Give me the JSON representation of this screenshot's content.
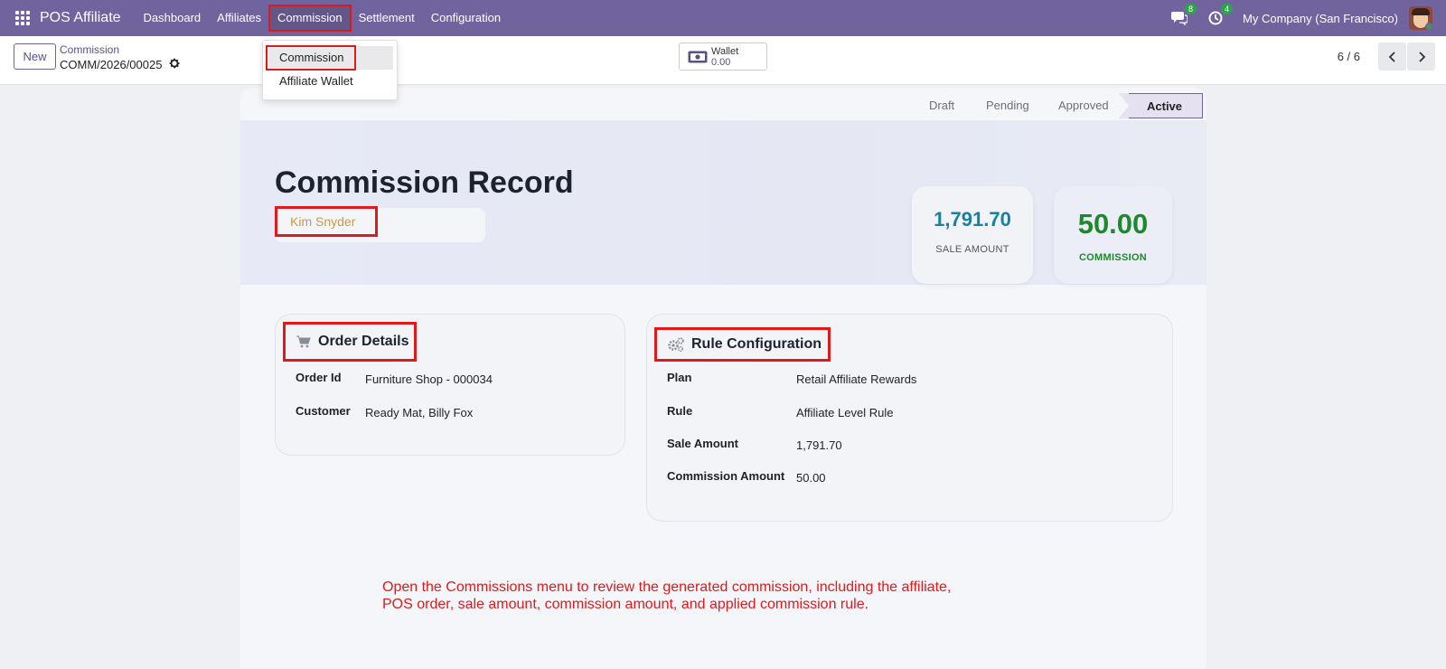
{
  "navbar": {
    "brand": "POS Affiliate",
    "menu": [
      "Dashboard",
      "Affiliates",
      "Commission",
      "Settlement",
      "Configuration"
    ],
    "active_menu": "Commission",
    "messages_count": "8",
    "activities_count": "4",
    "company": "My Company (San Francisco)",
    "icons": [
      "apps-grid-icon",
      "chat-icon",
      "clock-icon",
      "avatar"
    ]
  },
  "dropdown": {
    "items": [
      "Commission",
      "Affiliate Wallet"
    ]
  },
  "control": {
    "new_label": "New",
    "breadcrumb_parent": "Commission",
    "record_ref": "COMM/2026/00025",
    "wallet_label": "Wallet",
    "wallet_value": "0.00",
    "pager": "6 / 6"
  },
  "statusbar": {
    "stages": [
      "Draft",
      "Pending",
      "Approved",
      "Active"
    ],
    "current": "Active"
  },
  "hero": {
    "title": "Commission Record",
    "affiliate": "Kim Snyder",
    "sale_amount_value": "1,791.70",
    "sale_amount_label": "SALE AMOUNT",
    "commission_value": "50.00",
    "commission_label": "COMMISSION"
  },
  "order_details": {
    "title": "Order Details",
    "rows": [
      {
        "label": "Order Id",
        "value": "Furniture Shop - 000034"
      },
      {
        "label": "Customer",
        "value": "Ready Mat, Billy Fox"
      }
    ]
  },
  "rule_configuration": {
    "title": "Rule Configuration",
    "rows": [
      {
        "label": "Plan",
        "value": "Retail Affiliate Rewards"
      },
      {
        "label": "Rule",
        "value": "Affiliate Level Rule"
      },
      {
        "label": "Sale Amount",
        "value": "1,791.70"
      },
      {
        "label": "Commission Amount",
        "value": "50.00"
      }
    ]
  },
  "annotation": {
    "line1": "Open the Commissions menu to review the generated commission, including the affiliate,",
    "line2": "POS order, sale amount, commission amount, and applied commission rule."
  },
  "colors": {
    "navbar": "#71639e",
    "highlight": "#e0191b",
    "sale_amount": "#1b7fa0",
    "commission": "#1c8a2b",
    "affiliate_name": "#c79a45"
  }
}
